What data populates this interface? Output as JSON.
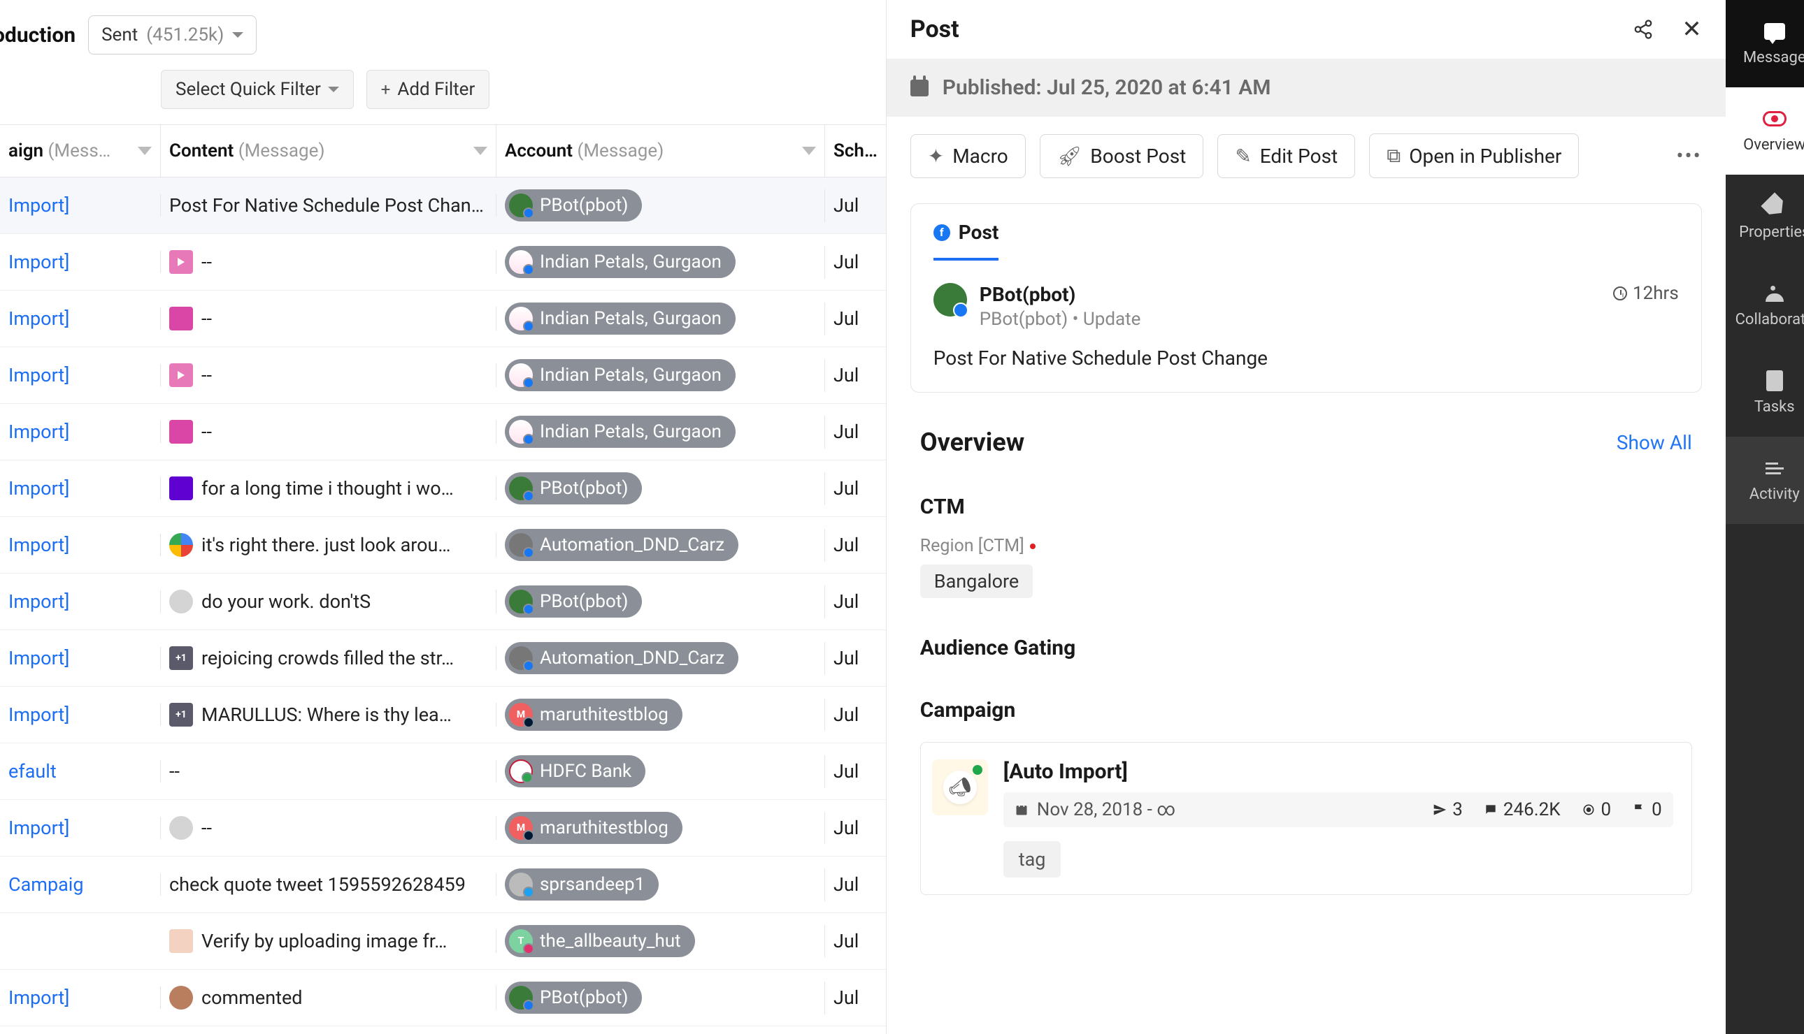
{
  "header": {
    "title_partial": "oduction",
    "sent_label": "Sent",
    "sent_count": "(451.25k)"
  },
  "filters": {
    "quick_filter": "Select Quick Filter",
    "add_filter": "Add Filter"
  },
  "columns": {
    "campaign": "aign",
    "campaign_qual": "(Mess…",
    "content": "Content",
    "content_qual": "(Message)",
    "account": "Account",
    "account_qual": "(Message)",
    "scheduled": "Sch…"
  },
  "rows": [
    {
      "campaign": "Import]",
      "content": "Post For Native Schedule Post Chan…",
      "account": "PBot(pbot)",
      "acct_cls": "green",
      "net": "fb",
      "sched": "Jul",
      "thumb": "none"
    },
    {
      "campaign": "Import]",
      "content": "--",
      "account": "Indian Petals, Gurgaon",
      "acct_cls": "petal",
      "net": "fb",
      "sched": "Jul",
      "thumb": "pinkvideo"
    },
    {
      "campaign": "Import]",
      "content": "--",
      "account": "Indian Petals, Gurgaon",
      "acct_cls": "petal",
      "net": "fb",
      "sched": "Jul",
      "thumb": "pink"
    },
    {
      "campaign": "Import]",
      "content": "--",
      "account": "Indian Petals, Gurgaon",
      "acct_cls": "petal",
      "net": "fb",
      "sched": "Jul",
      "thumb": "pinkvideo"
    },
    {
      "campaign": "Import]",
      "content": "--",
      "account": "Indian Petals, Gurgaon",
      "acct_cls": "petal",
      "net": "fb",
      "sched": "Jul",
      "thumb": "pink"
    },
    {
      "campaign": "Import]",
      "content": "for a long time i thought i wo…",
      "account": "PBot(pbot)",
      "acct_cls": "green",
      "net": "fb",
      "sched": "Jul",
      "thumb": "yahoo"
    },
    {
      "campaign": "Import]",
      "content": "it's right there. just look arou…",
      "account": "Automation_DND_Carz",
      "acct_cls": "car",
      "net": "fb",
      "sched": "Jul",
      "thumb": "google"
    },
    {
      "campaign": "Import]",
      "content": "do your work. don'tS",
      "account": "PBot(pbot)",
      "acct_cls": "green",
      "net": "fb",
      "sched": "Jul",
      "thumb": "grey"
    },
    {
      "campaign": "Import]",
      "content": "rejoicing crowds filled the str…",
      "account": "Automation_DND_Carz",
      "acct_cls": "car",
      "net": "fb",
      "sched": "Jul",
      "thumb": "dark+1"
    },
    {
      "campaign": "Import]",
      "content": "MARULLUS: Where is thy lea…",
      "account": "maruthitestblog",
      "acct_cls": "m",
      "net": "tum",
      "sched": "Jul",
      "thumb": "dark+1"
    },
    {
      "campaign": "efault",
      "content": "--",
      "account": "HDFC Bank",
      "acct_cls": "hdfc",
      "net": "g",
      "sched": "Jul",
      "thumb": "none"
    },
    {
      "campaign": "Import]",
      "content": "--",
      "account": "maruthitestblog",
      "acct_cls": "m",
      "net": "tum",
      "sched": "Jul",
      "thumb": "grey"
    },
    {
      "campaign": "Campaig",
      "content": "check quote tweet 1595592628459",
      "account": "sprsandeep1",
      "acct_cls": "s",
      "net": "tw",
      "sched": "Jul",
      "thumb": "none"
    },
    {
      "campaign": "",
      "content": "Verify by uploading image fr…",
      "account": "the_allbeauty_hut",
      "acct_cls": "t",
      "net": "ig",
      "sched": "Jul",
      "thumb": "avatar"
    },
    {
      "campaign": "Import]",
      "content": "commented",
      "account": "PBot(pbot)",
      "acct_cls": "green",
      "net": "fb",
      "sched": "Jul",
      "thumb": "avatar2"
    }
  ],
  "detail": {
    "title": "Post",
    "published": "Published: Jul 25, 2020 at 6:41 AM",
    "toolbar": {
      "macro": "Macro",
      "boost": "Boost Post",
      "edit": "Edit Post",
      "open": "Open in Publisher"
    },
    "post_tab": "Post",
    "post": {
      "name": "PBot(pbot)",
      "sub": "PBot(pbot) •    Update",
      "time": "12hrs",
      "text": "Post For Native Schedule Post Change"
    },
    "overview": {
      "title": "Overview",
      "show_all": "Show All",
      "ctm": {
        "title": "CTM",
        "label": "Region [CTM]",
        "value": "Bangalore"
      },
      "audience": {
        "title": "Audience Gating"
      },
      "campaign": {
        "title": "Campaign",
        "name": "[Auto Import]",
        "date": "Nov 28, 2018 - ∞",
        "stats": {
          "a": "3",
          "b": "246.2K",
          "c": "0",
          "d": "0"
        },
        "tag": "tag"
      }
    }
  },
  "rightnav": {
    "message": "Message",
    "overview": "Overview",
    "properties": "Properties",
    "collaborate": "Collaborate",
    "tasks": "Tasks",
    "activity": "Activity"
  }
}
